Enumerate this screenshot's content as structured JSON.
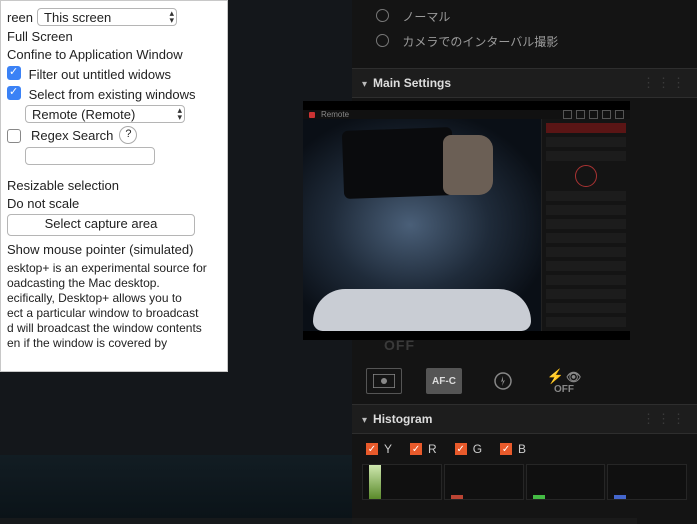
{
  "panel": {
    "screen_label_prefix": "reen",
    "screen_select": "This screen",
    "full_screen": "Full Screen",
    "confine": "Confine to Application Window",
    "filter_untitled": "Filter out untitled widows",
    "select_existing": "Select from existing windows",
    "window_select": "Remote (Remote)",
    "regex_search": "Regex Search",
    "resizable": "Resizable selection",
    "do_not_scale": "Do not scale",
    "select_area_btn": "Select capture area",
    "show_mouse": " Show mouse pointer (simulated)",
    "description": "esktop+ is an experimental source for\noadcasting the Mac desktop.\necifically, Desktop+ allows you to\nect a particular window to broadcast\nd will broadcast the window contents\nen if the window is covered by"
  },
  "cam": {
    "mode_normal": "ノーマル",
    "mode_interval": "カメラでのインターバル撮影",
    "main_settings": "Main Settings",
    "histogram": "Histogram",
    "off": "OFF",
    "afc": "AF-C",
    "hist_channels": [
      "Y",
      "R",
      "G",
      "B"
    ],
    "flash_off": "OFF"
  },
  "preview": {
    "app_name": "Remote"
  },
  "colors": {
    "accent_orange": "#e85a2b"
  }
}
